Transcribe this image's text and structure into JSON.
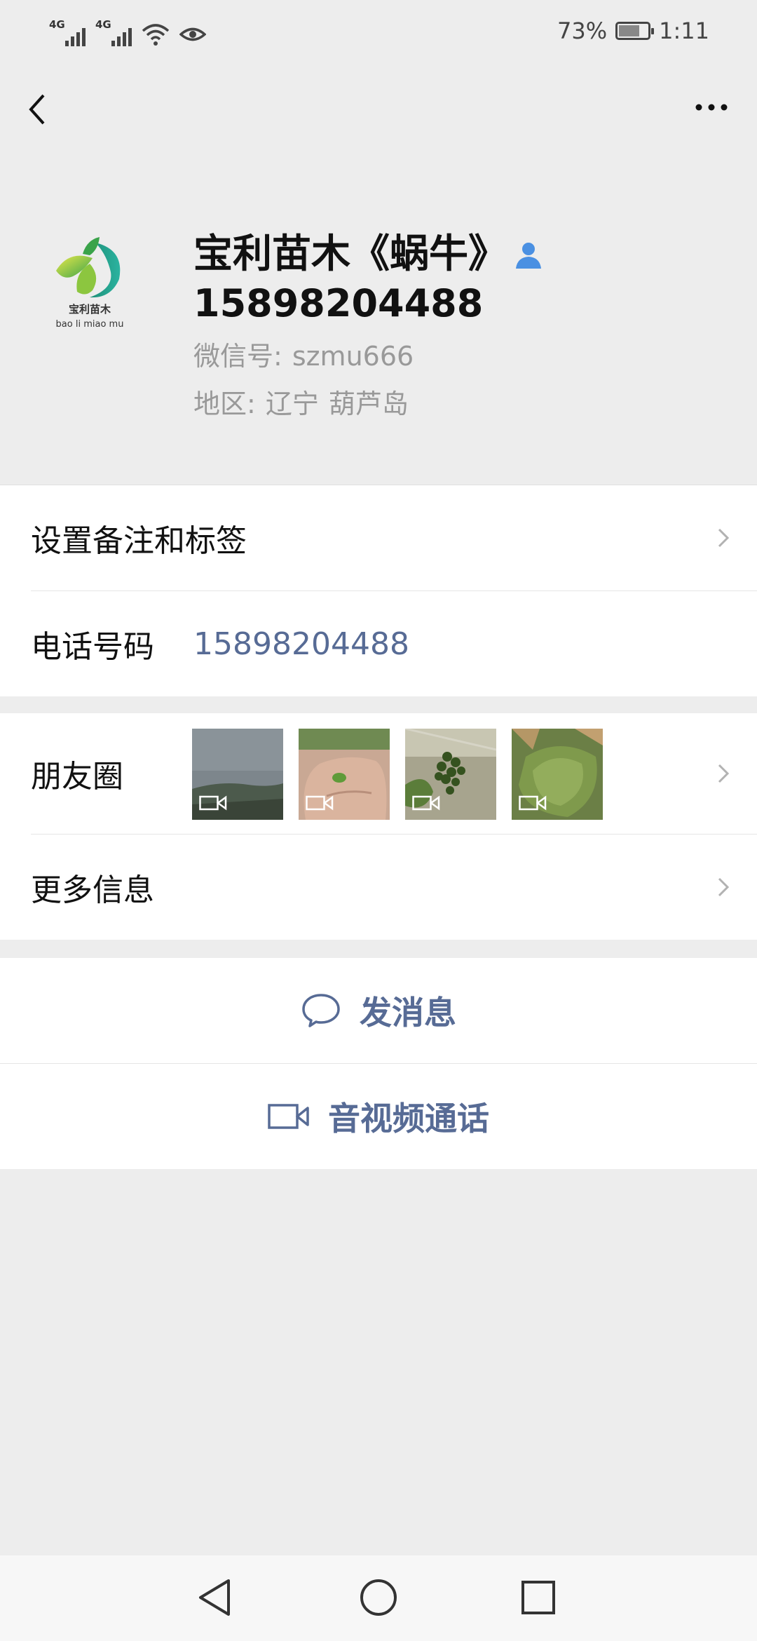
{
  "status_bar": {
    "signal1_label": "4G",
    "signal2_label": "4G",
    "battery_percent": "73%",
    "battery_level": 0.73,
    "time": "1:11"
  },
  "profile": {
    "name_line1": "宝利苗木《蜗牛》",
    "name_line2": "15898204488",
    "wechat_id_label": "微信号:",
    "wechat_id": "szmu666",
    "region_label": "地区:",
    "region_province": "辽宁",
    "region_city": "葫芦岛",
    "avatar_text_cn": "宝利苗木",
    "avatar_text_en": "bao li miao mu"
  },
  "rows": {
    "remark_label": "设置备注和标签",
    "phone_label": "电话号码",
    "phone_value": "15898204488",
    "moments_label": "朋友圈",
    "more_info_label": "更多信息"
  },
  "actions": {
    "message_label": "发消息",
    "call_label": "音视频通话"
  },
  "colors": {
    "link_blue": "#576b95",
    "background": "#ededed"
  }
}
